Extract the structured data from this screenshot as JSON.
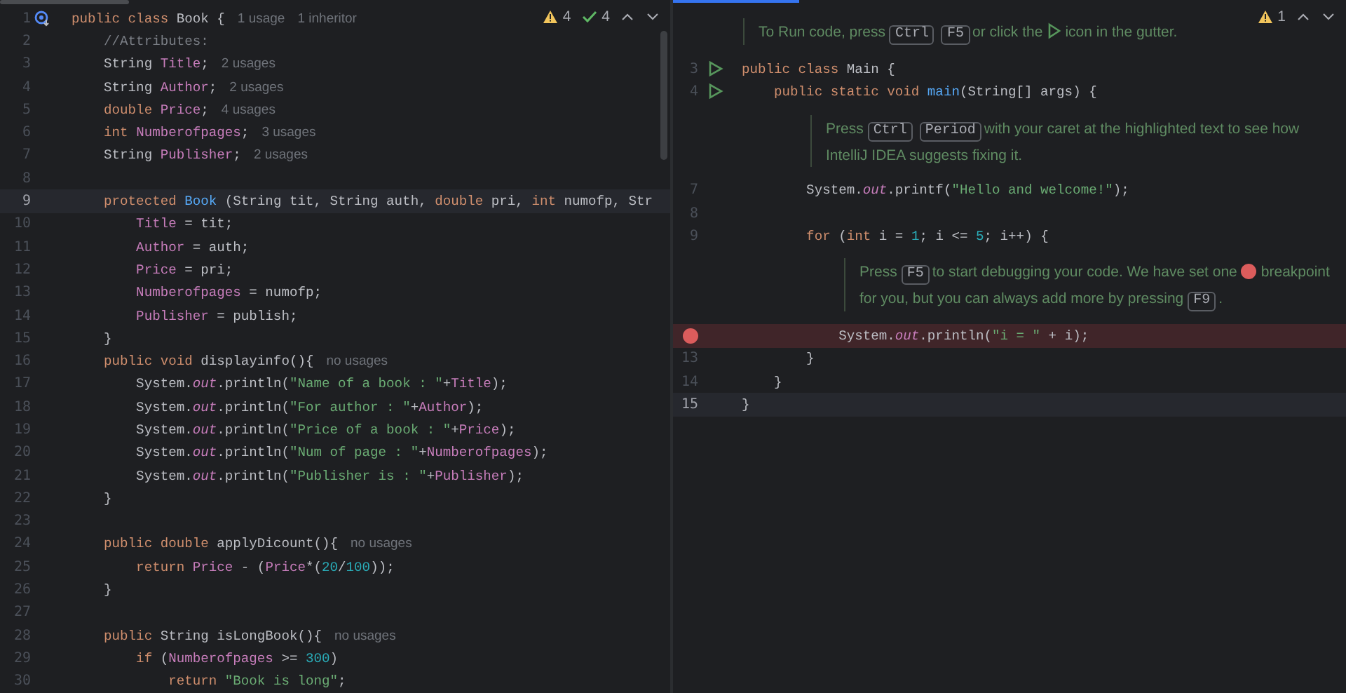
{
  "left_editor": {
    "inspections": [
      {
        "kind": "warning",
        "count": "4"
      },
      {
        "kind": "ok",
        "count": "4"
      }
    ],
    "lines": [
      {
        "number": "1",
        "current": false,
        "implemented": true,
        "tokens": [
          {
            "text": "public class",
            "kind": "keyword"
          },
          {
            "text": " Book {",
            "kind": "plain"
          }
        ],
        "hints": [
          "1 usage",
          "1 inheritor"
        ]
      },
      {
        "number": "2",
        "current": false,
        "implemented": false,
        "tokens": [
          {
            "text": "    //Attributes:",
            "kind": "comment"
          }
        ]
      },
      {
        "number": "3",
        "current": false,
        "implemented": false,
        "tokens": [
          {
            "text": "    String ",
            "kind": "plain"
          },
          {
            "text": "Title",
            "kind": "field"
          },
          {
            "text": ";",
            "kind": "plain"
          }
        ],
        "hints": [
          "2 usages"
        ]
      },
      {
        "number": "4",
        "current": false,
        "implemented": false,
        "tokens": [
          {
            "text": "    String ",
            "kind": "plain"
          },
          {
            "text": "Author",
            "kind": "field"
          },
          {
            "text": ";",
            "kind": "plain"
          }
        ],
        "hints": [
          "2 usages"
        ]
      },
      {
        "number": "5",
        "current": false,
        "implemented": false,
        "tokens": [
          {
            "text": "    double",
            "kind": "keyword"
          },
          {
            "text": " Price",
            "kind": "field"
          },
          {
            "text": ";",
            "kind": "plain"
          }
        ],
        "hints": [
          "4 usages"
        ]
      },
      {
        "number": "6",
        "current": false,
        "implemented": false,
        "tokens": [
          {
            "text": "    int",
            "kind": "keyword"
          },
          {
            "text": " Numberofpages",
            "kind": "field"
          },
          {
            "text": ";",
            "kind": "plain"
          }
        ],
        "hints": [
          "3 usages"
        ]
      },
      {
        "number": "7",
        "current": false,
        "implemented": false,
        "tokens": [
          {
            "text": "    String ",
            "kind": "plain"
          },
          {
            "text": "Publisher",
            "kind": "field"
          },
          {
            "text": ";",
            "kind": "plain"
          }
        ],
        "hints": [
          "2 usages"
        ]
      },
      {
        "number": "8",
        "current": false,
        "implemented": false
      },
      {
        "number": "9",
        "current": true,
        "implemented": false,
        "tokens": [
          {
            "text": "    protected",
            "kind": "keyword"
          },
          {
            "text": " Book",
            "kind": "method"
          },
          {
            "text": " (String tit, String auth, ",
            "kind": "plain"
          },
          {
            "text": "double",
            "kind": "keyword"
          },
          {
            "text": " pri, ",
            "kind": "plain"
          },
          {
            "text": "int",
            "kind": "keyword"
          },
          {
            "text": " numofp, Str",
            "kind": "plain"
          }
        ]
      },
      {
        "number": "10",
        "current": false,
        "implemented": false,
        "tokens": [
          {
            "text": "        Title",
            "kind": "field"
          },
          {
            "text": " = tit;",
            "kind": "plain"
          }
        ]
      },
      {
        "number": "11",
        "current": false,
        "implemented": false,
        "tokens": [
          {
            "text": "        Author",
            "kind": "field"
          },
          {
            "text": " = auth;",
            "kind": "plain"
          }
        ]
      },
      {
        "number": "12",
        "current": false,
        "implemented": false,
        "tokens": [
          {
            "text": "        Price",
            "kind": "field"
          },
          {
            "text": " = pri;",
            "kind": "plain"
          }
        ]
      },
      {
        "number": "13",
        "current": false,
        "implemented": false,
        "tokens": [
          {
            "text": "        Numberofpages",
            "kind": "field"
          },
          {
            "text": " = numofp;",
            "kind": "plain"
          }
        ]
      },
      {
        "number": "14",
        "current": false,
        "implemented": false,
        "tokens": [
          {
            "text": "        Publisher",
            "kind": "field"
          },
          {
            "text": " = publish;",
            "kind": "plain"
          }
        ]
      },
      {
        "number": "15",
        "current": false,
        "implemented": false,
        "tokens": [
          {
            "text": "    }",
            "kind": "plain"
          }
        ]
      },
      {
        "number": "16",
        "current": false,
        "implemented": false,
        "tokens": [
          {
            "text": "    public void",
            "kind": "keyword"
          },
          {
            "text": " displayinfo(){",
            "kind": "plain"
          }
        ],
        "hints": [
          "no usages"
        ]
      },
      {
        "number": "17",
        "current": false,
        "implemented": false,
        "tokens": [
          {
            "text": "        System.",
            "kind": "plain"
          },
          {
            "text": "out",
            "kind": "static"
          },
          {
            "text": ".println(",
            "kind": "plain"
          },
          {
            "text": "\"Name of a book : \"",
            "kind": "string"
          },
          {
            "text": "+",
            "kind": "plain"
          },
          {
            "text": "Title",
            "kind": "field"
          },
          {
            "text": ");",
            "kind": "plain"
          }
        ]
      },
      {
        "number": "18",
        "current": false,
        "implemented": false,
        "tokens": [
          {
            "text": "        System.",
            "kind": "plain"
          },
          {
            "text": "out",
            "kind": "static"
          },
          {
            "text": ".println(",
            "kind": "plain"
          },
          {
            "text": "\"For author : \"",
            "kind": "string"
          },
          {
            "text": "+",
            "kind": "plain"
          },
          {
            "text": "Author",
            "kind": "field"
          },
          {
            "text": ");",
            "kind": "plain"
          }
        ]
      },
      {
        "number": "19",
        "current": false,
        "implemented": false,
        "tokens": [
          {
            "text": "        System.",
            "kind": "plain"
          },
          {
            "text": "out",
            "kind": "static"
          },
          {
            "text": ".println(",
            "kind": "plain"
          },
          {
            "text": "\"Price of a book : \"",
            "kind": "string"
          },
          {
            "text": "+",
            "kind": "plain"
          },
          {
            "text": "Price",
            "kind": "field"
          },
          {
            "text": ");",
            "kind": "plain"
          }
        ]
      },
      {
        "number": "20",
        "current": false,
        "implemented": false,
        "tokens": [
          {
            "text": "        System.",
            "kind": "plain"
          },
          {
            "text": "out",
            "kind": "static"
          },
          {
            "text": ".println(",
            "kind": "plain"
          },
          {
            "text": "\"Num of page : \"",
            "kind": "string"
          },
          {
            "text": "+",
            "kind": "plain"
          },
          {
            "text": "Numberofpages",
            "kind": "field"
          },
          {
            "text": ");",
            "kind": "plain"
          }
        ]
      },
      {
        "number": "21",
        "current": false,
        "implemented": false,
        "tokens": [
          {
            "text": "        System.",
            "kind": "plain"
          },
          {
            "text": "out",
            "kind": "static"
          },
          {
            "text": ".println(",
            "kind": "plain"
          },
          {
            "text": "\"Publisher is : \"",
            "kind": "string"
          },
          {
            "text": "+",
            "kind": "plain"
          },
          {
            "text": "Publisher",
            "kind": "field"
          },
          {
            "text": ");",
            "kind": "plain"
          }
        ]
      },
      {
        "number": "22",
        "current": false,
        "implemented": false,
        "tokens": [
          {
            "text": "    }",
            "kind": "plain"
          }
        ]
      },
      {
        "number": "23",
        "current": false,
        "implemented": false
      },
      {
        "number": "24",
        "current": false,
        "implemented": false,
        "tokens": [
          {
            "text": "    public double",
            "kind": "keyword"
          },
          {
            "text": " applyDicount(){",
            "kind": "plain"
          }
        ],
        "hints": [
          "no usages"
        ]
      },
      {
        "number": "25",
        "current": false,
        "implemented": false,
        "tokens": [
          {
            "text": "        return",
            "kind": "keyword"
          },
          {
            "text": " Price",
            "kind": "field"
          },
          {
            "text": " - (",
            "kind": "plain"
          },
          {
            "text": "Price",
            "kind": "field"
          },
          {
            "text": "*(",
            "kind": "plain"
          },
          {
            "text": "20",
            "kind": "number"
          },
          {
            "text": "/",
            "kind": "plain"
          },
          {
            "text": "100",
            "kind": "number"
          },
          {
            "text": "));",
            "kind": "plain"
          }
        ]
      },
      {
        "number": "26",
        "current": false,
        "implemented": false,
        "tokens": [
          {
            "text": "    }",
            "kind": "plain"
          }
        ]
      },
      {
        "number": "27",
        "current": false,
        "implemented": false
      },
      {
        "number": "28",
        "current": false,
        "implemented": false,
        "tokens": [
          {
            "text": "    public",
            "kind": "keyword"
          },
          {
            "text": " String isLongBook(){",
            "kind": "plain"
          }
        ],
        "hints": [
          "no usages"
        ]
      },
      {
        "number": "29",
        "current": false,
        "implemented": false,
        "tokens": [
          {
            "text": "        if",
            "kind": "keyword"
          },
          {
            "text": " (",
            "kind": "plain"
          },
          {
            "text": "Numberofpages",
            "kind": "field"
          },
          {
            "text": " >= ",
            "kind": "plain"
          },
          {
            "text": "300",
            "kind": "number"
          },
          {
            "text": ")",
            "kind": "plain"
          }
        ]
      },
      {
        "number": "30",
        "current": false,
        "implemented": false,
        "tokens": [
          {
            "text": "            return",
            "kind": "keyword"
          },
          {
            "text": " \"Book is long\"",
            "kind": "string"
          },
          {
            "text": ";",
            "kind": "plain"
          }
        ]
      }
    ]
  },
  "right_editor": {
    "inspections": [
      {
        "kind": "warning",
        "count": "1"
      }
    ],
    "items": [
      {
        "kind": "tip",
        "parts": [
          {
            "kind": "text",
            "text": "To Run code, press"
          },
          {
            "kind": "key",
            "text": "Ctrl"
          },
          {
            "kind": "key",
            "text": "F5"
          },
          {
            "kind": "text",
            "text": "or click the"
          },
          {
            "kind": "run"
          },
          {
            "kind": "text",
            "text": "icon in the gutter."
          }
        ]
      },
      {
        "kind": "code",
        "number": "3",
        "current": false,
        "breakpoint": false,
        "runnable": true,
        "tokens": [
          {
            "text": "public class",
            "kind": "keyword"
          },
          {
            "text": " Main {",
            "kind": "plain"
          }
        ]
      },
      {
        "kind": "code",
        "number": "4",
        "current": false,
        "breakpoint": false,
        "runnable": true,
        "tokens": [
          {
            "text": "    public static void",
            "kind": "keyword"
          },
          {
            "text": " main",
            "kind": "method"
          },
          {
            "text": "(String[] args) {",
            "kind": "plain"
          }
        ]
      },
      {
        "kind": "tip",
        "parts": [
          {
            "kind": "text",
            "text": "Press"
          },
          {
            "kind": "key",
            "text": "Ctrl"
          },
          {
            "kind": "key",
            "text": "Period"
          },
          {
            "kind": "text",
            "text": "with your caret at the highlighted text to see how IntelliJ IDEA suggests fixing it."
          }
        ]
      },
      {
        "kind": "code",
        "number": "7",
        "current": false,
        "breakpoint": false,
        "runnable": false,
        "tokens": [
          {
            "text": "        System.",
            "kind": "plain"
          },
          {
            "text": "out",
            "kind": "static"
          },
          {
            "text": ".printf(",
            "kind": "plain"
          },
          {
            "text": "\"Hello and welcome!\"",
            "kind": "string"
          },
          {
            "text": ");",
            "kind": "plain"
          }
        ]
      },
      {
        "kind": "code",
        "number": "8",
        "current": false,
        "breakpoint": false,
        "runnable": false
      },
      {
        "kind": "code",
        "number": "9",
        "current": false,
        "breakpoint": false,
        "runnable": false,
        "tokens": [
          {
            "text": "        for",
            "kind": "keyword"
          },
          {
            "text": " (",
            "kind": "plain"
          },
          {
            "text": "int",
            "kind": "keyword"
          },
          {
            "text": " i = ",
            "kind": "plain"
          },
          {
            "text": "1",
            "kind": "number"
          },
          {
            "text": "; i <= ",
            "kind": "plain"
          },
          {
            "text": "5",
            "kind": "number"
          },
          {
            "text": "; i++) {",
            "kind": "plain"
          }
        ]
      },
      {
        "kind": "tip",
        "parts": [
          {
            "kind": "text",
            "text": "Press"
          },
          {
            "kind": "key",
            "text": "F5"
          },
          {
            "kind": "text",
            "text": "to start debugging your code. We have set one"
          },
          {
            "kind": "breakpoint"
          },
          {
            "kind": "text",
            "text": "breakpoint for you, but you can always add more by pressing"
          },
          {
            "kind": "key",
            "text": "F9"
          },
          {
            "kind": "text",
            "text": "."
          }
        ]
      },
      {
        "kind": "code",
        "current": false,
        "breakpoint": true,
        "runnable": false,
        "tokens": [
          {
            "text": "            System.",
            "kind": "plain"
          },
          {
            "text": "out",
            "kind": "static"
          },
          {
            "text": ".println(",
            "kind": "plain"
          },
          {
            "text": "\"i = \"",
            "kind": "string"
          },
          {
            "text": " + i);",
            "kind": "plain"
          }
        ]
      },
      {
        "kind": "code",
        "number": "13",
        "current": false,
        "breakpoint": false,
        "runnable": false,
        "tokens": [
          {
            "text": "        }",
            "kind": "plain"
          }
        ]
      },
      {
        "kind": "code",
        "number": "14",
        "current": false,
        "breakpoint": false,
        "runnable": false,
        "tokens": [
          {
            "text": "    }",
            "kind": "plain"
          }
        ]
      },
      {
        "kind": "code",
        "number": "15",
        "current": true,
        "breakpoint": false,
        "runnable": false,
        "tokens": [
          {
            "text": "}",
            "kind": "plain"
          }
        ]
      }
    ]
  }
}
